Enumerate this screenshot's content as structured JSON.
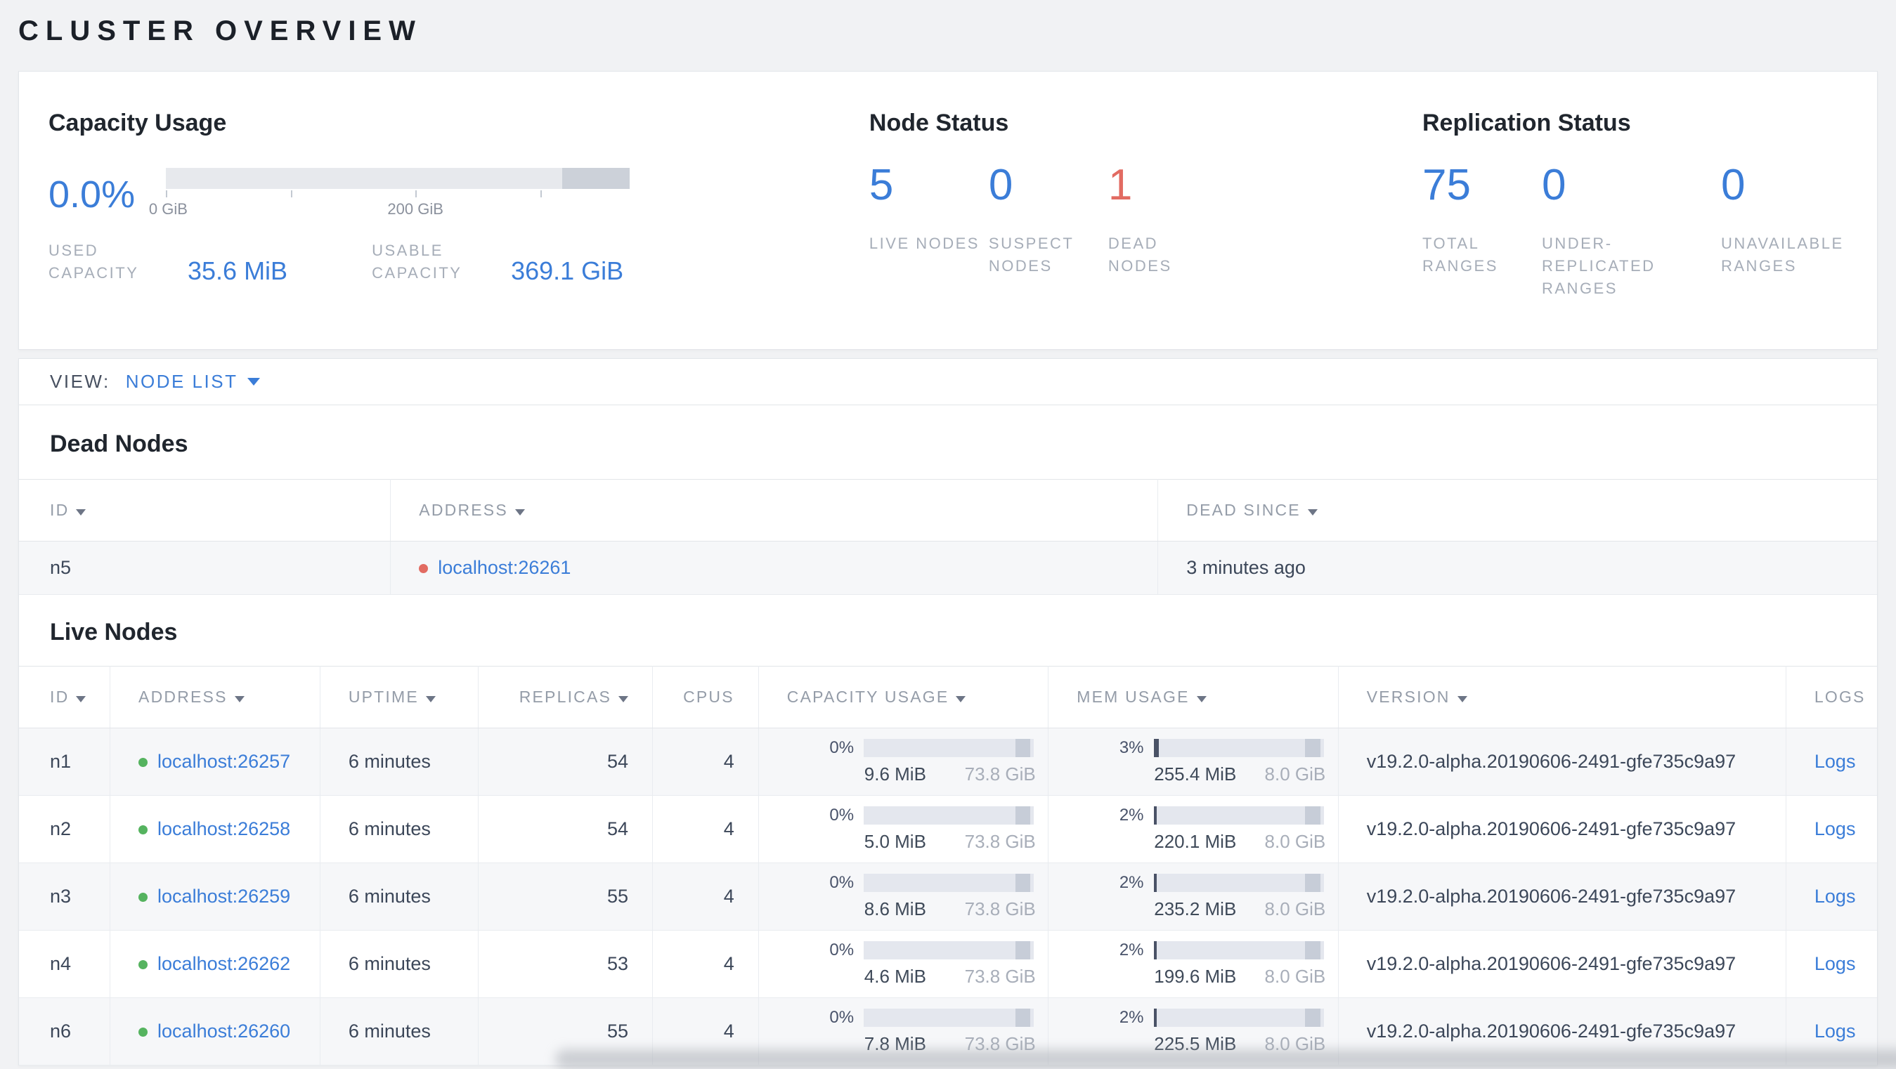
{
  "page": {
    "title": "CLUSTER OVERVIEW"
  },
  "summary": {
    "capacity": {
      "title": "Capacity Usage",
      "percent": "0.0%",
      "axis": {
        "tick0": "0 GiB",
        "tick200": "200 GiB"
      },
      "used": {
        "label": "USED CAPACITY",
        "value": "35.6 MiB"
      },
      "usable": {
        "label": "USABLE CAPACITY",
        "value": "369.1 GiB"
      }
    },
    "node_status": {
      "title": "Node Status",
      "live": {
        "value": "5",
        "label": "LIVE NODES"
      },
      "suspect": {
        "value": "0",
        "label": "SUSPECT NODES"
      },
      "dead": {
        "value": "1",
        "label": "DEAD NODES"
      }
    },
    "replication": {
      "title": "Replication Status",
      "total": {
        "value": "75",
        "label": "TOTAL RANGES"
      },
      "under": {
        "value": "0",
        "label": "UNDER-REPLICATED RANGES"
      },
      "unavailable": {
        "value": "0",
        "label": "UNAVAILABLE RANGES"
      }
    }
  },
  "view_bar": {
    "label": "VIEW:",
    "selected": "NODE LIST"
  },
  "dead_nodes": {
    "title": "Dead Nodes",
    "headers": {
      "id": "ID",
      "address": "ADDRESS",
      "dead_since": "DEAD SINCE"
    },
    "rows": [
      {
        "id": "n5",
        "address": "localhost:26261",
        "dead_since": "3 minutes ago"
      }
    ]
  },
  "live_nodes": {
    "title": "Live Nodes",
    "headers": {
      "id": "ID",
      "address": "ADDRESS",
      "uptime": "UPTIME",
      "replicas": "REPLICAS",
      "cpus": "CPUS",
      "capacity": "CAPACITY USAGE",
      "mem": "MEM USAGE",
      "version": "VERSION",
      "logs": "LOGS"
    },
    "rows": [
      {
        "id": "n1",
        "address": "localhost:26257",
        "uptime": "6 minutes",
        "replicas": "54",
        "cpus": "4",
        "capacity": {
          "percent": "0%",
          "fill": 0,
          "used": "9.6 MiB",
          "total": "73.8 GiB"
        },
        "mem": {
          "percent": "3%",
          "fill": 3,
          "used": "255.4 MiB",
          "total": "8.0 GiB"
        },
        "version": "v19.2.0-alpha.20190606-2491-gfe735c9a97",
        "logs_label": "Logs"
      },
      {
        "id": "n2",
        "address": "localhost:26258",
        "uptime": "6 minutes",
        "replicas": "54",
        "cpus": "4",
        "capacity": {
          "percent": "0%",
          "fill": 0,
          "used": "5.0 MiB",
          "total": "73.8 GiB"
        },
        "mem": {
          "percent": "2%",
          "fill": 2,
          "used": "220.1 MiB",
          "total": "8.0 GiB"
        },
        "version": "v19.2.0-alpha.20190606-2491-gfe735c9a97",
        "logs_label": "Logs"
      },
      {
        "id": "n3",
        "address": "localhost:26259",
        "uptime": "6 minutes",
        "replicas": "55",
        "cpus": "4",
        "capacity": {
          "percent": "0%",
          "fill": 0,
          "used": "8.6 MiB",
          "total": "73.8 GiB"
        },
        "mem": {
          "percent": "2%",
          "fill": 2,
          "used": "235.2 MiB",
          "total": "8.0 GiB"
        },
        "version": "v19.2.0-alpha.20190606-2491-gfe735c9a97",
        "logs_label": "Logs"
      },
      {
        "id": "n4",
        "address": "localhost:26262",
        "uptime": "6 minutes",
        "replicas": "53",
        "cpus": "4",
        "capacity": {
          "percent": "0%",
          "fill": 0,
          "used": "4.6 MiB",
          "total": "73.8 GiB"
        },
        "mem": {
          "percent": "2%",
          "fill": 2,
          "used": "199.6 MiB",
          "total": "8.0 GiB"
        },
        "version": "v19.2.0-alpha.20190606-2491-gfe735c9a97",
        "logs_label": "Logs"
      },
      {
        "id": "n6",
        "address": "localhost:26260",
        "uptime": "6 minutes",
        "replicas": "55",
        "cpus": "4",
        "capacity": {
          "percent": "0%",
          "fill": 0,
          "used": "7.8 MiB",
          "total": "73.8 GiB"
        },
        "mem": {
          "percent": "2%",
          "fill": 2,
          "used": "225.5 MiB",
          "total": "8.0 GiB"
        },
        "version": "v19.2.0-alpha.20190606-2491-gfe735c9a97",
        "logs_label": "Logs"
      }
    ]
  },
  "colors": {
    "accent_blue": "#3b7dd8",
    "danger_red": "#e26b62",
    "healthy_green": "#55b35f"
  }
}
